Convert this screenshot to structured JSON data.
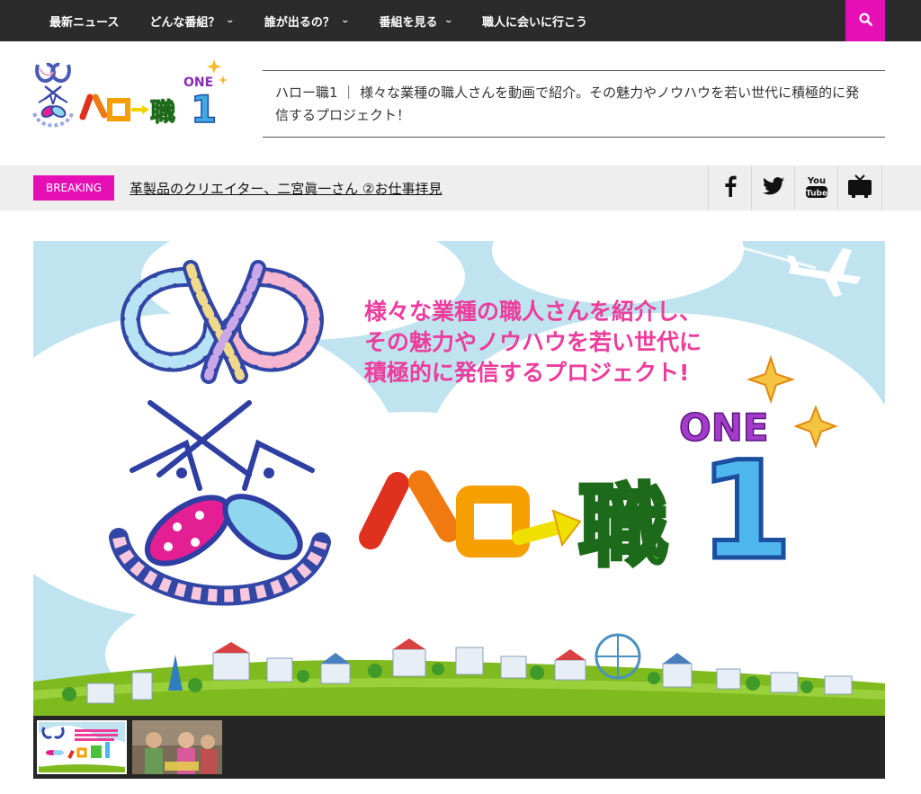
{
  "nav": {
    "items": [
      {
        "label": "最新ニュース",
        "dropdown": false
      },
      {
        "label": "どんな番組？",
        "dropdown": true
      },
      {
        "label": "誰が出るの？",
        "dropdown": true
      },
      {
        "label": "番組を見る",
        "dropdown": true
      },
      {
        "label": "職人に会いに行こう",
        "dropdown": false
      }
    ],
    "search_icon": "search-icon"
  },
  "header": {
    "logo": {
      "brand": "ハロー職",
      "one": "ONE",
      "num": "1"
    },
    "tagline": "ハロー職1 ｜ 様々な業種の職人さんを動画で紹介。その魅力やノウハウを若い世代に積極的に発信するプロジェクト！"
  },
  "breaking": {
    "badge": "BREAKING",
    "headline": "革製品のクリエイター、二宮眞一さん ②お仕事拝見"
  },
  "social": [
    {
      "name": "facebook-icon",
      "label": "f"
    },
    {
      "name": "twitter-icon",
      "label": ""
    },
    {
      "name": "youtube-icon",
      "label": "You Tube"
    },
    {
      "name": "tv-icon",
      "label": ""
    }
  ],
  "hero": {
    "text_lines": [
      "様々な業種の職人さんを紹介し、",
      "その魅力やノウハウを若い世代に",
      "積極的に発信するプロジェクト!"
    ],
    "logo": {
      "ha": "ハ",
      "ro": "ロ",
      "shoku": "職",
      "one": "ONE",
      "num": "1"
    }
  },
  "colors": {
    "accent": "#e60fb5",
    "nav_bg": "#2b2b2b",
    "bar_bg": "#eeeeee",
    "sky": "#bfe3ef",
    "grass": "#7fba1e"
  }
}
